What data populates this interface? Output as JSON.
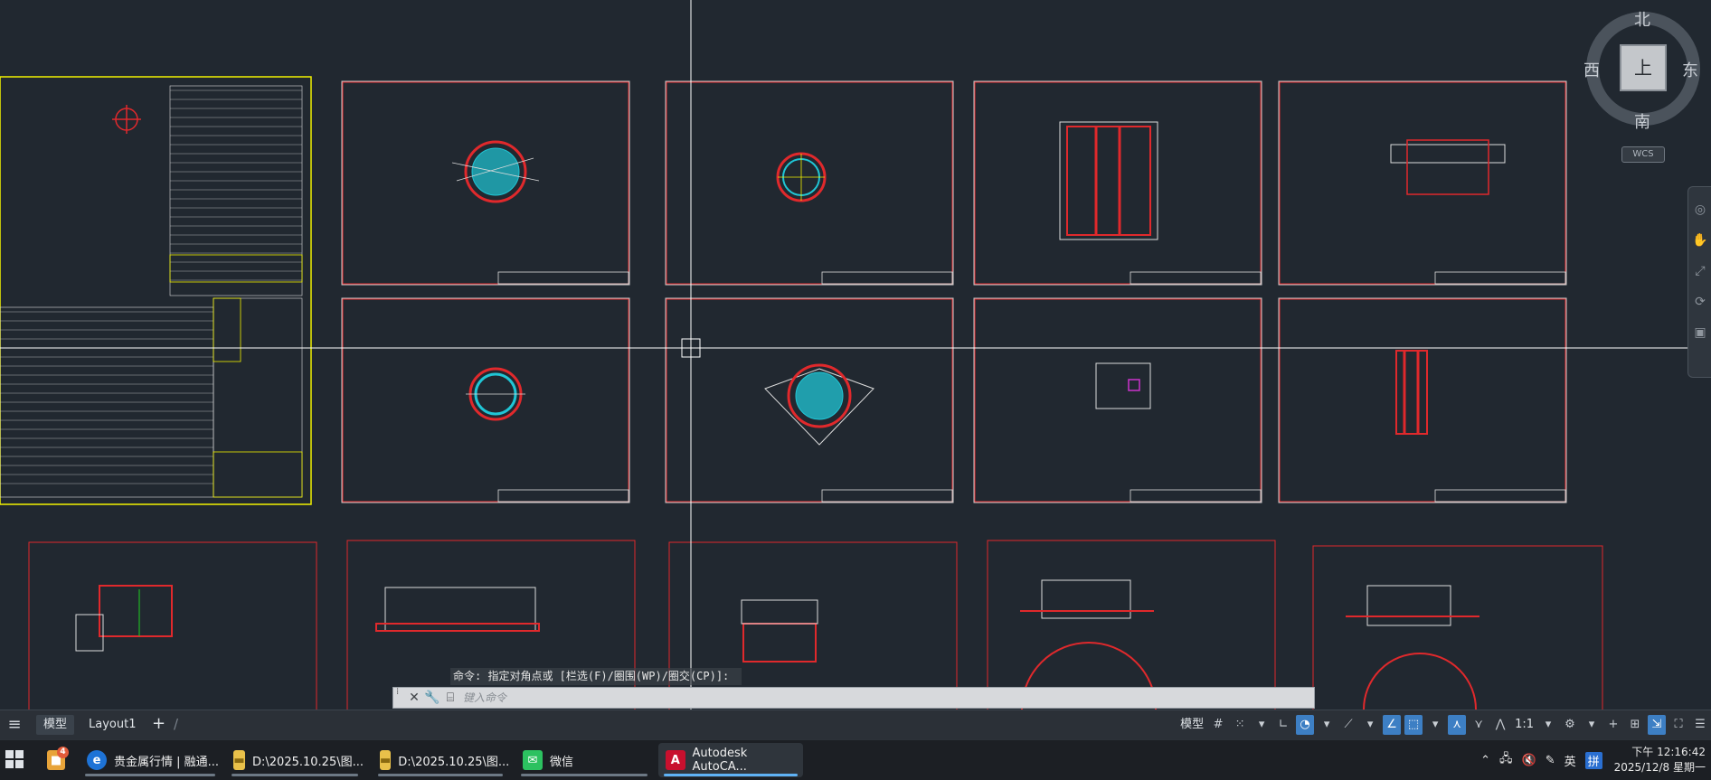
{
  "viewcube": {
    "north": "北",
    "south": "南",
    "east": "东",
    "west": "西",
    "face": "上",
    "wcs_label": "WCS"
  },
  "command": {
    "history_line": "命令: 指定对角点或 [栏选(F)/圈围(WP)/圈交(CP)]:",
    "input_placeholder": "键入命令"
  },
  "layout_tabs": {
    "model": "模型",
    "layout1": "Layout1"
  },
  "status_bar": {
    "model_space": "模型",
    "scale": "1:1"
  },
  "taskbar": {
    "apps": [
      {
        "label": "贵金属行情 | 融通...",
        "icon": "browser-icon"
      },
      {
        "label": "D:\\2025.10.25\\图...",
        "icon": "folder-icon"
      },
      {
        "label": "D:\\2025.10.25\\图...",
        "icon": "folder-icon"
      },
      {
        "label": "微信",
        "icon": "wechat-icon"
      },
      {
        "label": "Autodesk AutoCA...",
        "icon": "autocad-icon"
      }
    ],
    "badge_count": "4",
    "tray": {
      "lang": "英",
      "time": "下午 12:16:42",
      "date": "2025/12/8 星期一"
    }
  },
  "colors": {
    "canvas_bg": "#212830",
    "frame_border": "#c8c8c8",
    "sheet_border": "#e0292c",
    "drawing_cyan": "#20c6d6",
    "drawing_yellow": "#f2f200",
    "accent": "#3d7fc4"
  }
}
